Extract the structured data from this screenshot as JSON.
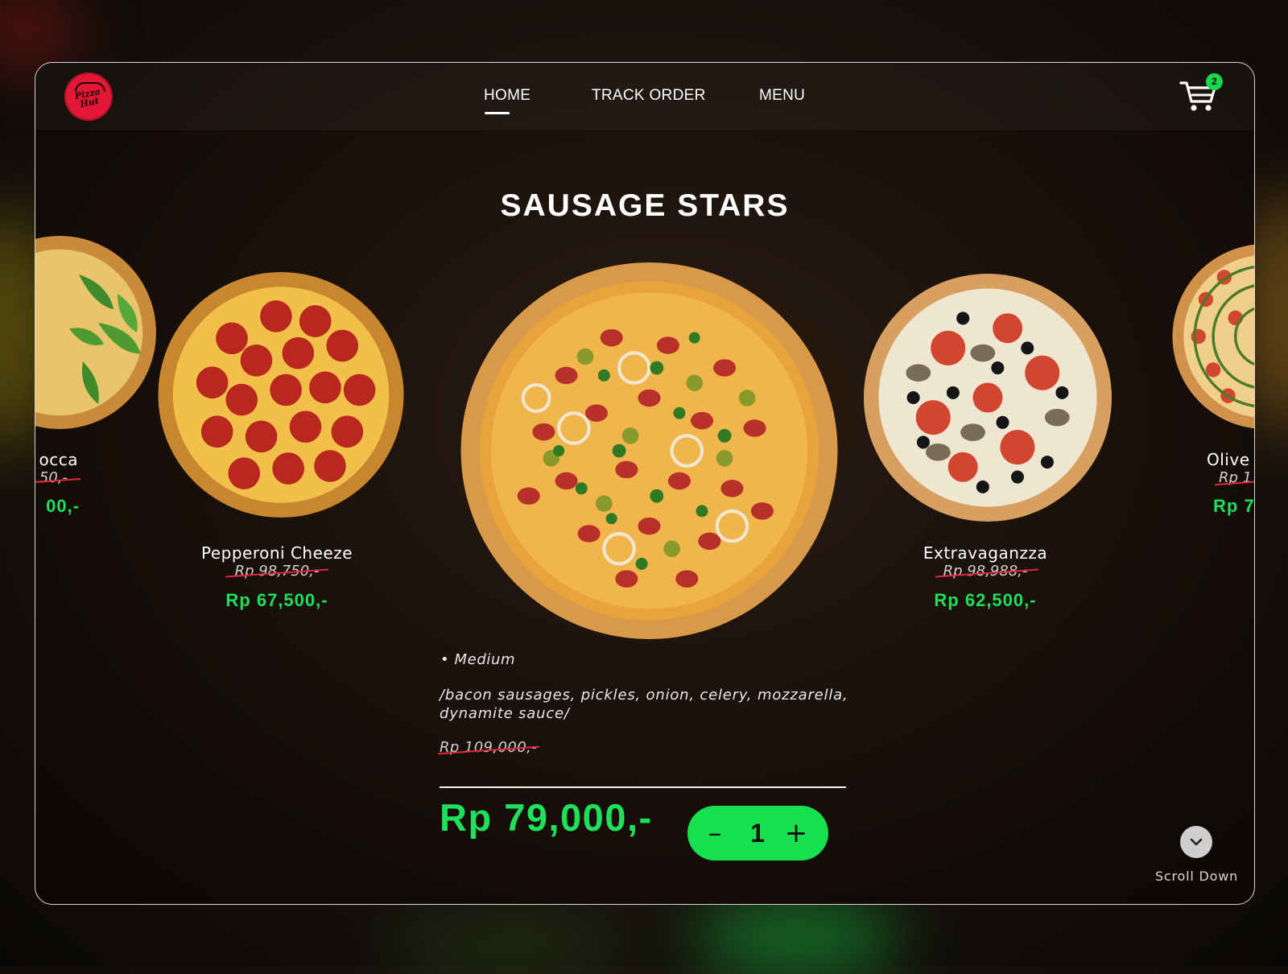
{
  "app": {
    "brand": "Pizza Hut"
  },
  "nav": {
    "items": [
      {
        "label": "HOME",
        "active": true
      },
      {
        "label": "TRACK ORDER"
      },
      {
        "label": "MENU"
      }
    ],
    "cart_count": "2"
  },
  "featured": {
    "title": "SAUSAGE STARS",
    "size": "• Medium",
    "ingredients": "/bacon sausages, pickles, onion, celery, mozzarella, dynamite sauce/",
    "old_price": "Rp 109,000,-",
    "price": "Rp 79,000,-",
    "quantity": "1",
    "minus": "–",
    "plus": "+"
  },
  "carousel": [
    {
      "name": "occa",
      "old_price": "50,-",
      "price": "00,-"
    },
    {
      "name": "Pepperoni Cheeze",
      "old_price": "Rp 98,750,-",
      "price": "Rp 67,500,-"
    },
    {
      "name": "Extravaganzza",
      "old_price": "Rp 98,988,-",
      "price": "Rp 62,500,-"
    },
    {
      "name": "Olive",
      "old_price": "Rp 1",
      "price": "Rp 7"
    }
  ],
  "scroll": {
    "label": "Scroll Down"
  },
  "colors": {
    "accent_green": "#1fe05a",
    "strike_red": "#e0283a",
    "brand_red": "#e31837"
  },
  "icons": {
    "logo": "pizza-hut-logo",
    "cart": "cart-icon",
    "scroll": "chevron-down-icon"
  }
}
